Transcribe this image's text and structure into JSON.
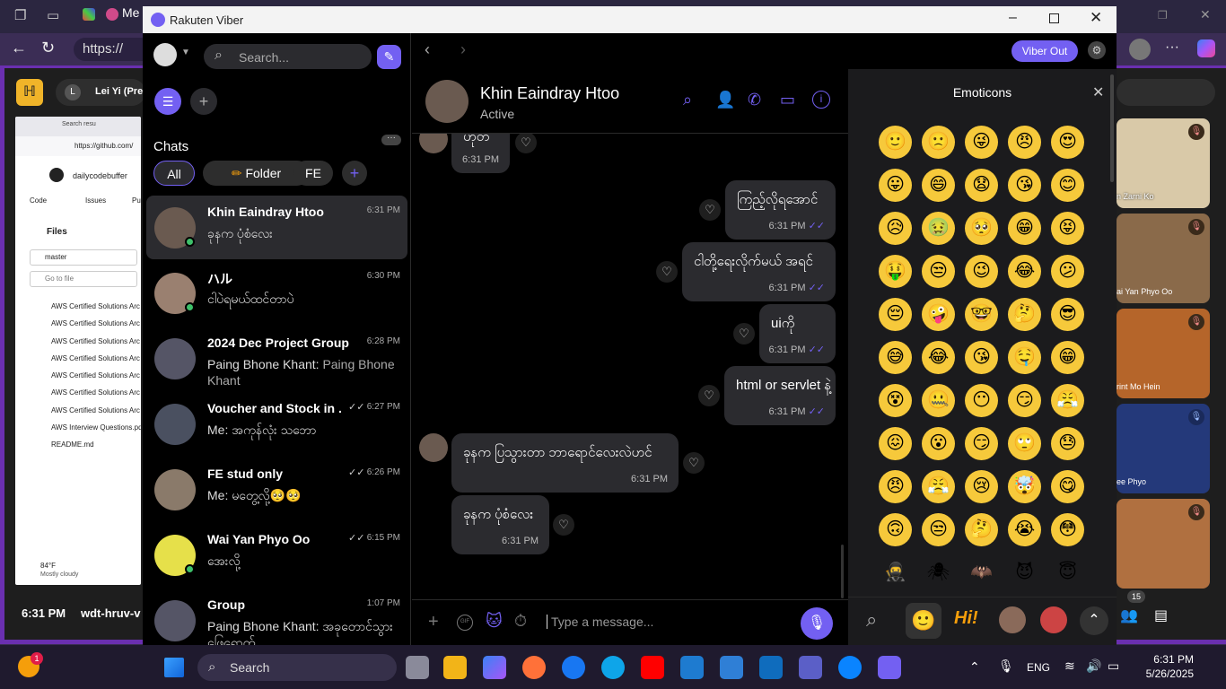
{
  "background_browser": {
    "tab_title": "Me",
    "url": "https://",
    "meet_name": "Lei Yi (Pre",
    "github_url": "https://github.com/",
    "github_search_tab": "Search resu",
    "repo": "dailycodebuffer",
    "repo_tabs": [
      "Code",
      "Issues",
      "Pu"
    ],
    "files_label": "Files",
    "branch": "master",
    "goto_placeholder": "Go to file",
    "files": [
      "AWS Certified Solutions Arc",
      "AWS Certified Solutions Arc",
      "AWS Certified Solutions Arc",
      "AWS Certified Solutions Arc",
      "AWS Certified Solutions Arc",
      "AWS Certified Solutions Arc",
      "AWS Certified Solutions Arc",
      "AWS Interview Questions.pd",
      "README.md"
    ],
    "weather_temp": "84°F",
    "weather_desc": "Mostly cloudy",
    "meet_time": "6:31 PM",
    "meet_code": "wdt-hruv-v",
    "participants": [
      "n Zarni Ko",
      "ai Yan Phyo Oo",
      "rint Mo Hein",
      "ee Phyo"
    ],
    "participant_count": "15"
  },
  "viber": {
    "window_title": "Rakuten Viber",
    "search_placeholder": "Search...",
    "chats_heading": "Chats",
    "filters": [
      "All",
      "Folder",
      "FE"
    ],
    "viber_out": "Viber Out",
    "chats": [
      {
        "name": "Khin Eaindray Htoo",
        "time": "6:31 PM",
        "preview": "ခုနက ပုံစံလေး"
      },
      {
        "name": "ハル",
        "time": "6:30 PM",
        "preview": "ငါပဲရမယ်ထင်တာပဲ"
      },
      {
        "name": "2024 Dec Project Group",
        "time": "6:28 PM",
        "sender": "Paing Bhone Khant:",
        "preview": "Paing Bhone Khant"
      },
      {
        "name": "Voucher and Stock in ...",
        "time": "6:27 PM",
        "preview": "Me: အကုန်လုံး သဘော"
      },
      {
        "name": "FE stud only",
        "time": "6:26 PM",
        "preview": "Me: မတွေ့လို့🥺🥺"
      },
      {
        "name": "Wai Yan Phyo Oo",
        "time": "6:15 PM",
        "preview": "အေးလို့"
      },
      {
        "name": "Group",
        "time": "1:07 PM",
        "preview": "Paing Bhone Khant: အခုတောင်သွား ဖြေရောက်"
      }
    ],
    "contact": {
      "name": "Khin Eaindray Htoo",
      "status": "Active"
    },
    "messages": [
      {
        "text": "ဟုတ်",
        "time": "6:31 PM"
      },
      {
        "text": "ကြည့်လိုရအောင်",
        "time": "6:31 PM"
      },
      {
        "text": "ငါတို့ရေးလိုက်မယ် အရင်",
        "time": "6:31 PM"
      },
      {
        "text": "uiကို",
        "time": "6:31 PM"
      },
      {
        "text": "html or servlet နဲ့",
        "time": "6:31 PM"
      },
      {
        "text": "ခုနက ပြသွားတာ ဘာရောင်လေးလဲဟင်",
        "time": "6:31 PM"
      },
      {
        "text": "ခုနက ပုံစံလေး",
        "time": "6:31 PM"
      }
    ],
    "message_placeholder": "Type a message...",
    "emoticons_title": "Emoticons",
    "emojis": [
      "🙂",
      "🙁",
      "😜",
      "😠",
      "😍",
      "😛",
      "😄",
      "😧",
      "😘",
      "😊",
      "😥",
      "🤢",
      "🥺",
      "😁",
      "😝",
      "🤑",
      "😒",
      "😉",
      "😂",
      "😕",
      "😔",
      "🤪",
      "🤓",
      "🤔",
      "😎",
      "😅",
      "😂",
      "😘",
      "🤤",
      "😁",
      "😵",
      "🤐",
      "😶",
      "😏",
      "😤",
      "😖",
      "😮",
      "😏",
      "🙄",
      "😓",
      "😠",
      "😤",
      "😢",
      "🤯",
      "😋",
      "🙃",
      "😒",
      "🤔",
      "😭",
      "😳",
      "🥷",
      "🕷",
      "🦇",
      "😈",
      "😇"
    ]
  },
  "taskbar": {
    "search": "Search",
    "lang": "ENG",
    "time": "6:31 PM",
    "date": "5/26/2025",
    "badge": "1"
  }
}
